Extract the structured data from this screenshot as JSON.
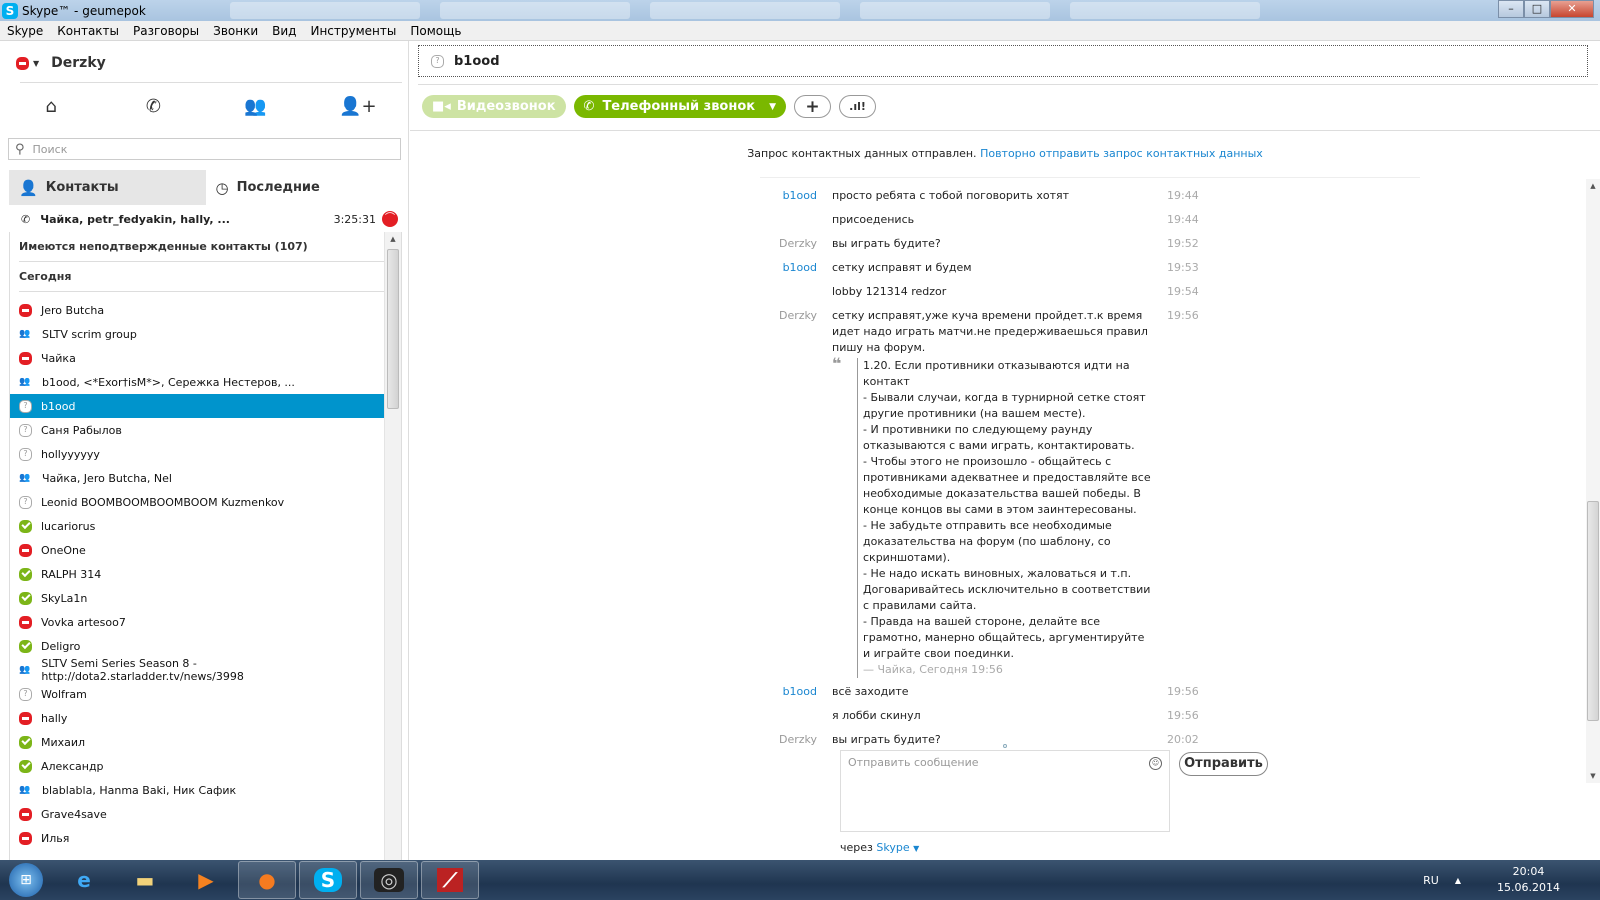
{
  "window": {
    "title": "Skype™ - geumepok",
    "controls": [
      "minimize",
      "maximize",
      "close"
    ]
  },
  "menu": [
    "Skype",
    "Контакты",
    "Разговоры",
    "Звонки",
    "Вид",
    "Инструменты",
    "Помощь"
  ],
  "profile": {
    "name": "Derzky",
    "status": "busy"
  },
  "search": {
    "placeholder": "Поиск"
  },
  "tabs": {
    "contacts": "Контакты",
    "recent": "Последние"
  },
  "active_call": {
    "participants": "Чайка, petr_fedyakin, hally, ...",
    "duration": "3:25:31"
  },
  "unconfirmed": "Имеются неподтвержденные контакты (107)",
  "section_today": "Сегодня",
  "contacts": [
    {
      "name": "Jero Butcha",
      "status": "busy"
    },
    {
      "name": "SLTV scrim group",
      "status": "group"
    },
    {
      "name": "Чайка",
      "status": "busy"
    },
    {
      "name": "b1ood, <*Exor†isM*>, Сережка Нестеров, ...",
      "status": "group"
    },
    {
      "name": "b1ood",
      "status": "unknown",
      "selected": true
    },
    {
      "name": "Саня Рабылов",
      "status": "unknown"
    },
    {
      "name": "hollyyyyyy",
      "status": "unknown"
    },
    {
      "name": "Чайка, Jero Butcha, Nel",
      "status": "group"
    },
    {
      "name": "Leonid BOOMBOOMBOOMBOOM Kuzmenkov",
      "status": "unknown"
    },
    {
      "name": "lucariorus",
      "status": "online"
    },
    {
      "name": "OneOne",
      "status": "busy"
    },
    {
      "name": "RALPH 314",
      "status": "online"
    },
    {
      "name": "SkyLa1n",
      "status": "online"
    },
    {
      "name": "Vovka artesoo7",
      "status": "busy"
    },
    {
      "name": "Deligro",
      "status": "online"
    },
    {
      "name": "SLTV Semi Series Season 8 - http://dota2.starladder.tv/news/3998",
      "status": "group"
    },
    {
      "name": "Wolfram",
      "status": "unknown"
    },
    {
      "name": "hally",
      "status": "busy"
    },
    {
      "name": "Михаил",
      "status": "online"
    },
    {
      "name": "Александр",
      "status": "online"
    },
    {
      "name": "blablabla, Hanma Baki, Ник Сафик",
      "status": "group"
    },
    {
      "name": "Grave4save",
      "status": "busy"
    },
    {
      "name": "Илья",
      "status": "busy"
    }
  ],
  "chat": {
    "contact": "b1ood",
    "buttons": {
      "video": "Видеозвонок",
      "call": "Телефонный звонок"
    },
    "info": "Запрос контактных данных отправлен.",
    "info_link": "Повторно отправить запрос контактных данных",
    "messages": [
      {
        "author": "b1ood",
        "them": true,
        "text": "просто ребята с тобой поговорить хотят",
        "time": "19:44"
      },
      {
        "author": "",
        "them": true,
        "text": "присоеденись",
        "time": "19:44"
      },
      {
        "author": "Derzky",
        "them": false,
        "text": "вы играть будите?",
        "time": "19:52"
      },
      {
        "author": "b1ood",
        "them": true,
        "text": "сетку исправят и будем",
        "time": "19:53"
      },
      {
        "author": "",
        "them": true,
        "text": "lobby 121314 redzor",
        "time": "19:54"
      },
      {
        "author": "Derzky",
        "them": false,
        "text": "сетку исправят,уже куча времени пройдет.т.к время идет надо играть матчи.не предерживаешься правил пишу на форум.",
        "time": "19:56"
      }
    ],
    "quote": {
      "lines": [
        "1.20. Если противники отказываются идти на контакт",
        "- Бывали случаи, когда в турнирной сетке стоят другие противники (на вашем месте).",
        "- И противники по следующему раунду отказываются с вами играть, контактировать.",
        "- Чтобы этого не произошло - общайтесь с противниками адекватнее и предоставляйте все необходимые доказательства вашей победы. В конце концов вы сами в этом заинтересованы.",
        "- Не забудьте отправить все необходимые доказательства на форум (по шаблону, со скриншотами).",
        "- Не надо искать виновных, жаловаться и т.п. Договаривайтесь исключительно в соответствии с правилами сайта.",
        "- Правда на вашей стороне, делайте все грамотно, манерно общайтесь, аргументируйте и играйте свои поединки."
      ],
      "footer": "— Чайка, Сегодня 19:56"
    },
    "messages_after": [
      {
        "author": "b1ood",
        "them": true,
        "text": "всё заходите",
        "time": "19:56"
      },
      {
        "author": "",
        "them": true,
        "text": "я лобби скинул",
        "time": "19:56"
      },
      {
        "author": "Derzky",
        "them": false,
        "text": "вы играть будите?",
        "time": "20:02"
      }
    ],
    "composer_placeholder": "Отправить сообщение",
    "send": "Отправить",
    "via": "через",
    "via_link": "Skype"
  },
  "taskbar": {
    "apps": [
      "internet-explorer",
      "file-explorer",
      "media-player",
      "firefox",
      "skype",
      "steam",
      "dota2"
    ],
    "lang": "RU",
    "time": "20:04",
    "date": "15.06.2014"
  }
}
